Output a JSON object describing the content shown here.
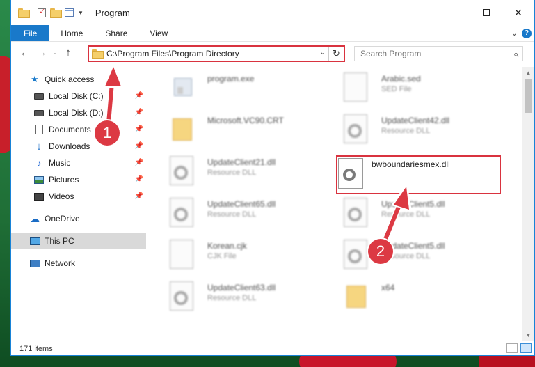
{
  "window": {
    "title": "Program",
    "controls": {
      "minimize": "",
      "maximize": "",
      "close": "✕"
    }
  },
  "ribbon": {
    "tabs": [
      "File",
      "Home",
      "Share",
      "View"
    ],
    "help": "?"
  },
  "nav": {
    "back": "←",
    "forward": "→",
    "recent": "⌄",
    "up": "↑",
    "address": "C:\\Program Files\\Program Directory",
    "refresh": "↻",
    "search_placeholder": "Search Program"
  },
  "sidebar": {
    "items": [
      {
        "label": "Quick access",
        "pinned": false
      },
      {
        "label": "Local Disk (C:)",
        "pinned": true
      },
      {
        "label": "Local Disk (D:)",
        "pinned": true
      },
      {
        "label": "Documents",
        "pinned": true
      },
      {
        "label": "Downloads",
        "pinned": true
      },
      {
        "label": "Music",
        "pinned": true
      },
      {
        "label": "Pictures",
        "pinned": true
      },
      {
        "label": "Videos",
        "pinned": true
      },
      {
        "label": "OneDrive",
        "pinned": false
      },
      {
        "label": "This PC",
        "pinned": false,
        "selected": true
      },
      {
        "label": "Network",
        "pinned": false
      }
    ]
  },
  "files": {
    "col1": [
      {
        "name": "program.exe",
        "sub": ""
      },
      {
        "name": "Microsoft.VC90.CRT",
        "sub": ""
      },
      {
        "name": "UpdateClient21.dll",
        "sub": "Resource DLL"
      },
      {
        "name": "UpdateClient65.dll",
        "sub": "Resource DLL"
      },
      {
        "name": "Korean.cjk",
        "sub": "CJK File"
      },
      {
        "name": "UpdateClient63.dll",
        "sub": "Resource DLL"
      }
    ],
    "col2": [
      {
        "name": "Arabic.sed",
        "sub": "SED File"
      },
      {
        "name": "UpdateClient42.dll",
        "sub": "Resource DLL"
      },
      {
        "name": "bwboundariesmex.dll",
        "sub": "",
        "highlighted": true
      },
      {
        "name": "UpdateClient5.dll",
        "sub": "Resource DLL"
      },
      {
        "name": "UpdateClient5.dll",
        "sub": "Resource DLL"
      },
      {
        "name": "x64",
        "sub": ""
      }
    ]
  },
  "status": {
    "items": "171 items"
  },
  "annotations": {
    "step1": "1",
    "step2": "2"
  },
  "colors": {
    "accent": "#1979ca",
    "highlight": "#d9333f",
    "badge": "#dc3943"
  }
}
